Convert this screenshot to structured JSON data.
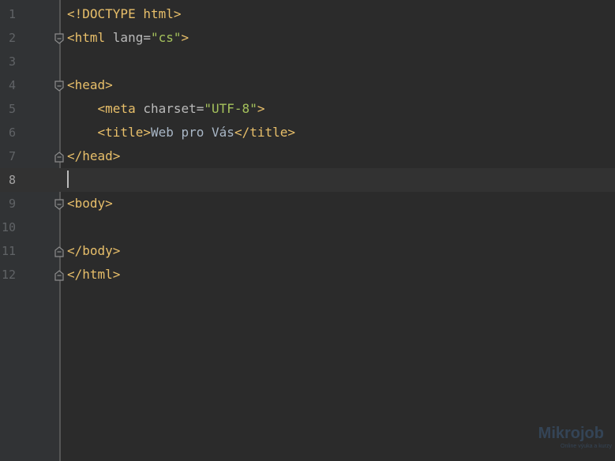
{
  "editor": {
    "current_line": 8,
    "lines": [
      {
        "number": "1",
        "parts": [
          {
            "t": "tag",
            "v": "<!DOCTYPE html>"
          }
        ]
      },
      {
        "number": "2",
        "parts": [
          {
            "t": "tag",
            "v": "<html "
          },
          {
            "t": "attr",
            "v": "lang="
          },
          {
            "t": "str",
            "v": "\"cs\""
          },
          {
            "t": "tag",
            "v": ">"
          }
        ]
      },
      {
        "number": "3",
        "parts": []
      },
      {
        "number": "4",
        "parts": [
          {
            "t": "tag",
            "v": "<head>"
          }
        ]
      },
      {
        "number": "5",
        "parts": [
          {
            "t": "txt",
            "v": "    "
          },
          {
            "t": "tag",
            "v": "<meta "
          },
          {
            "t": "attr",
            "v": "charset="
          },
          {
            "t": "str",
            "v": "\"UTF-8\""
          },
          {
            "t": "tag",
            "v": ">"
          }
        ]
      },
      {
        "number": "6",
        "parts": [
          {
            "t": "txt",
            "v": "    "
          },
          {
            "t": "tag",
            "v": "<title>"
          },
          {
            "t": "txt",
            "v": "Web pro Vás"
          },
          {
            "t": "tag",
            "v": "</title>"
          }
        ]
      },
      {
        "number": "7",
        "parts": [
          {
            "t": "tag",
            "v": "</head>"
          }
        ]
      },
      {
        "number": "8",
        "parts": []
      },
      {
        "number": "9",
        "parts": [
          {
            "t": "tag",
            "v": "<body>"
          }
        ]
      },
      {
        "number": "10",
        "parts": []
      },
      {
        "number": "11",
        "parts": [
          {
            "t": "tag",
            "v": "</body>"
          }
        ]
      },
      {
        "number": "12",
        "parts": [
          {
            "t": "tag",
            "v": "</html>"
          }
        ]
      }
    ],
    "fold_markers": {
      "2": "fold-open-icon",
      "4": "fold-open-icon",
      "7": "fold-close-icon",
      "9": "fold-open-icon",
      "11": "fold-close-icon",
      "12": "fold-close-icon"
    }
  },
  "watermark": {
    "name": "Mikrojob",
    "tagline": "Online výuka a kurzy"
  },
  "colors": {
    "background": "#2b2b2b",
    "gutter": "#313335",
    "tag": "#e8bf6a",
    "attribute": "#bababa",
    "string": "#a5c25c",
    "text": "#a9b7c6",
    "line_number": "#606366"
  }
}
